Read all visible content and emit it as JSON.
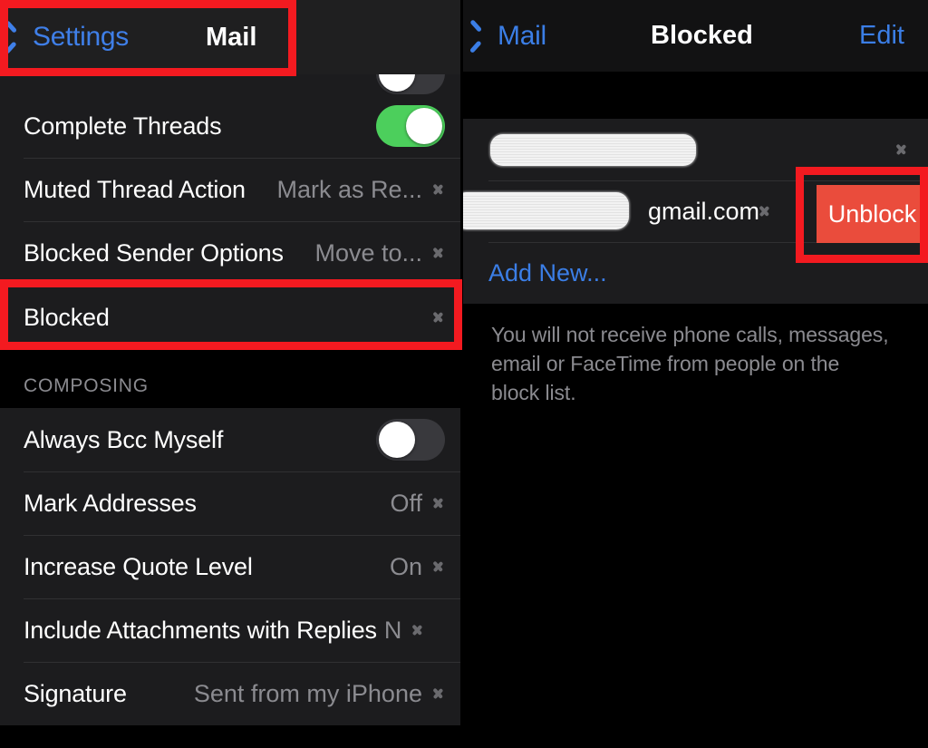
{
  "left_panel": {
    "navbar": {
      "back_label": "Settings",
      "title": "Mail"
    },
    "clipped_row": {
      "label": "",
      "toggle": "off"
    },
    "threading_group": [
      {
        "label": "Complete Threads",
        "type": "toggle",
        "toggle": "on",
        "value": ""
      },
      {
        "label": "Muted Thread Action",
        "type": "value",
        "value": "Mark as Re..."
      },
      {
        "label": "Blocked Sender Options",
        "type": "value",
        "value": "Move to..."
      },
      {
        "label": "Blocked",
        "type": "value",
        "value": ""
      }
    ],
    "composing_header": "COMPOSING",
    "composing_group": [
      {
        "label": "Always Bcc Myself",
        "type": "toggle",
        "toggle": "off",
        "value": ""
      },
      {
        "label": "Mark Addresses",
        "type": "value",
        "value": "Off"
      },
      {
        "label": "Increase Quote Level",
        "type": "value",
        "value": "On"
      },
      {
        "label": "Include Attachments with Replies",
        "type": "value",
        "value": "N"
      },
      {
        "label": "Signature",
        "type": "value",
        "value": "Sent from my iPhone"
      }
    ]
  },
  "right_panel": {
    "navbar": {
      "back_label": "Mail",
      "title": "Blocked",
      "edit_label": "Edit"
    },
    "blocked_rows": [
      {
        "redacted": true,
        "text": ""
      },
      {
        "redacted": true,
        "text": "gmail.com"
      }
    ],
    "add_new_label": "Add New...",
    "unblock_label": "Unblock",
    "footer_text": "You will not receive phone calls, messages, email or FaceTime from people on the block list."
  },
  "annotations": {
    "accent_red": "#f31a20",
    "unblock_red": "#ea4c3c",
    "toggle_on_green": "#4ccf5c",
    "link_blue": "#3b7ee6"
  }
}
